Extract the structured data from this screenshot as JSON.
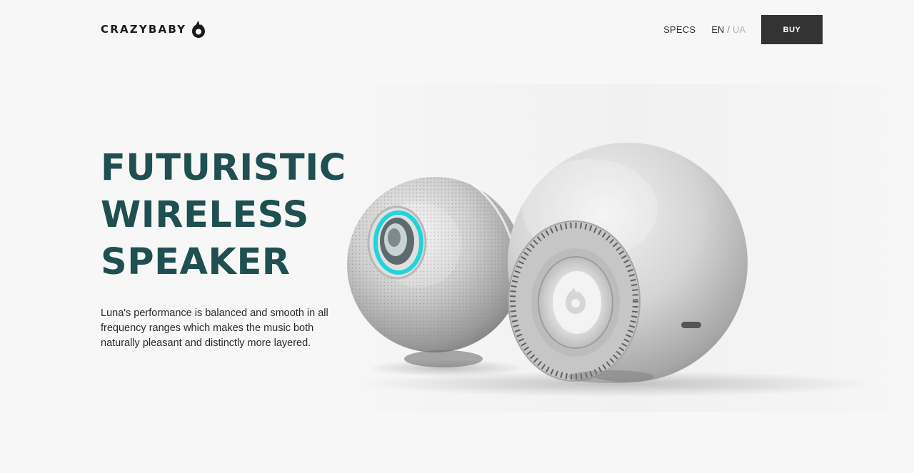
{
  "header": {
    "logo_text": "CRAZYBABY",
    "nav": {
      "specs_label": "SPECS",
      "lang_active": "EN",
      "lang_separator": "/",
      "lang_inactive": "UA",
      "buy_label": "BUY"
    }
  },
  "hero": {
    "title_lines": [
      "FUTURISTIC",
      "WIRELESS",
      "SPEAKER"
    ],
    "description": "Luna's performance is balanced and smooth in all frequency ranges which makes the music both naturally pleasant and distinctly more layered."
  },
  "colors": {
    "background": "#f7f7f7",
    "title": "#1f4f50",
    "button": "#333333",
    "accent_glow": "#22d3d8"
  },
  "icons": {
    "logo": "flame-drop-icon"
  }
}
